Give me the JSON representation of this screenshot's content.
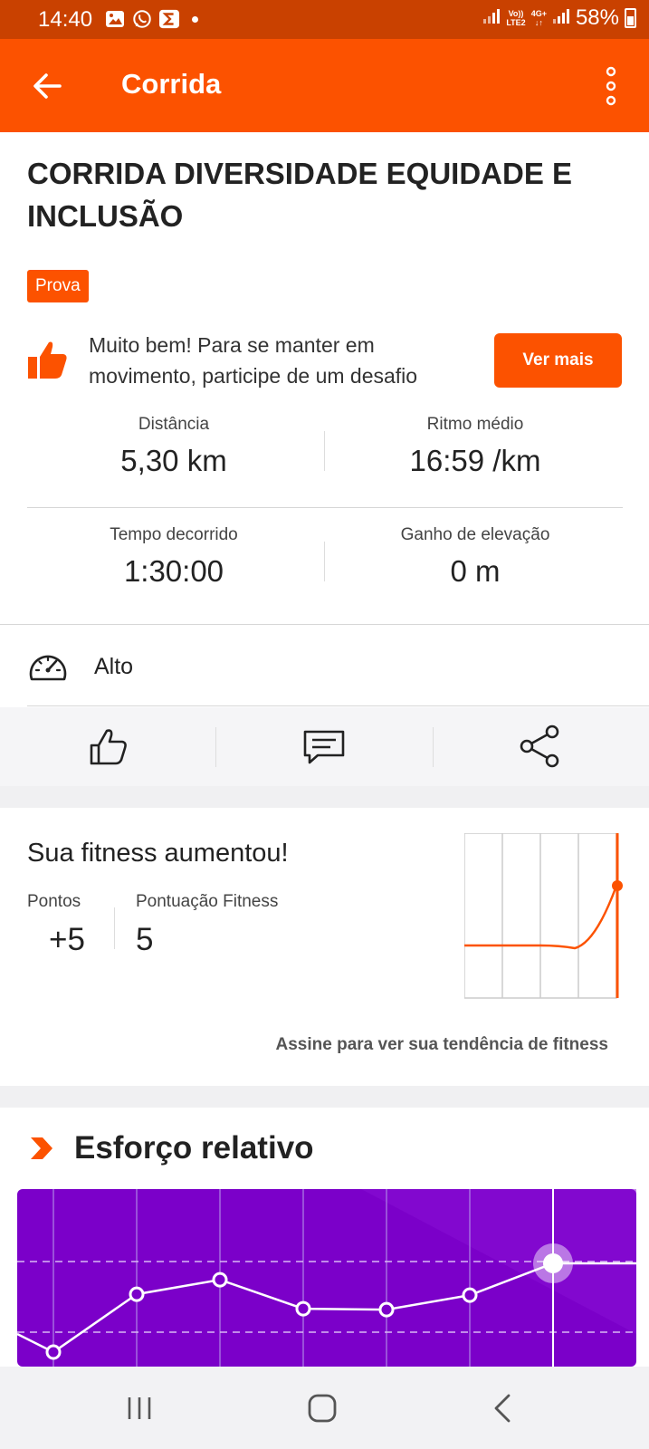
{
  "status_bar": {
    "time": "14:40",
    "network_top": "Vo))",
    "network_bottom": "LTE2",
    "network_gen": "4G+",
    "battery": "58%"
  },
  "app_bar": {
    "title": "Corrida",
    "icons": [
      "back-arrow-icon",
      "overflow-menu-icon"
    ]
  },
  "activity": {
    "title": "CORRIDA DIVERSIDADE EQUIDADE E INCLUSÃO",
    "tag": "Prova"
  },
  "promo": {
    "text": "Muito bem! Para se manter em movimento, participe de um desafio",
    "button": "Ver mais"
  },
  "stats": [
    {
      "label": "Distância",
      "value": "5,30 km"
    },
    {
      "label": "Ritmo médio",
      "value": "16:59 /km"
    },
    {
      "label": "Tempo decorrido",
      "value": "1:30:00"
    },
    {
      "label": "Ganho de elevação",
      "value": "0 m"
    }
  ],
  "effort_level": {
    "label": "Alto",
    "icon": "speedometer-icon"
  },
  "actions": [
    "like-icon",
    "comment-icon",
    "share-icon"
  ],
  "fitness": {
    "title": "Sua fitness aumentou!",
    "points_label": "Pontos",
    "points_value": "+5",
    "score_label": "Pontuação Fitness",
    "score_value": "5",
    "cta": "Assine para ver sua tendência de fitness"
  },
  "relative_effort": {
    "title": "Esforço relativo",
    "icon": "chevron-badge-icon",
    "accent_color": "#7b00c9"
  },
  "colors": {
    "brand": "#fc5200",
    "status_bar": "#c94100",
    "chart_purple": "#7b00c9"
  },
  "chart_data": [
    {
      "type": "line",
      "title": "",
      "x": [
        0,
        1,
        2,
        3,
        4
      ],
      "series": [
        {
          "values": [
            0,
            0,
            0,
            0,
            5
          ]
        }
      ],
      "grid": true
    },
    {
      "type": "line",
      "title": "",
      "x": [
        1,
        2,
        3,
        4,
        5,
        6,
        7,
        8
      ],
      "series": [
        {
          "values": [
            -30,
            30,
            45,
            15,
            14,
            29,
            62,
            62
          ]
        }
      ],
      "grid": true
    }
  ]
}
